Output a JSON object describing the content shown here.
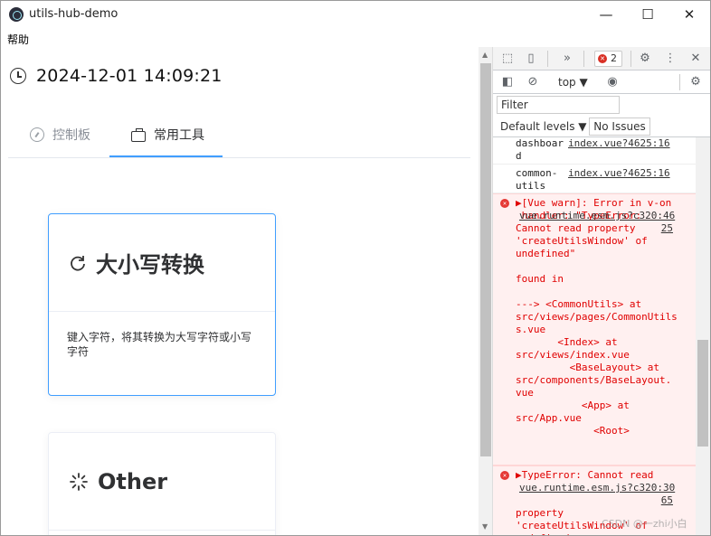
{
  "window": {
    "title": "utils-hub-demo",
    "minimize_glyph": "—",
    "maximize_glyph": "☐",
    "close_glyph": "✕"
  },
  "menu": {
    "help": "帮助"
  },
  "clock": {
    "datetime": "2024-12-01 14:09:21"
  },
  "tabs": [
    {
      "label": "控制板",
      "active": false
    },
    {
      "label": "常用工具",
      "active": true
    }
  ],
  "cards": [
    {
      "title": "大小写转换",
      "description": "键入字符，将其转换为大写字符或小写字符"
    },
    {
      "title": "Other"
    }
  ],
  "devtools": {
    "more_tools": "»",
    "error_count": "2",
    "context": "top",
    "filter_placeholder": "Filter",
    "default_levels": "Default levels",
    "no_issues": "No Issues",
    "logs": [
      {
        "message": "dashboar\nd",
        "link": "index.vue?4625:16"
      },
      {
        "message": "common-\nutils",
        "link": "index.vue?4625:16"
      }
    ],
    "errors": [
      {
        "text": "▶[Vue warn]: Error in v-on\n handler: \"TypeError:\nCannot read property\n'createUtilsWindow' of\nundefined\"\n\nfound in\n\n---> <CommonUtils> at\nsrc/views/pages/CommonUtils\ns.vue\n       <Index> at\nsrc/views/index.vue\n         <BaseLayout> at\nsrc/components/BaseLayout.\nvue\n           <App> at\nsrc/App.vue\n             <Root>",
        "link": "vue.runtime.esm.js?c320:46\n25"
      },
      {
        "text": "▶TypeError: Cannot read\n\n\nproperty\n'createUtilsWindow' of\nundefined",
        "link": "vue.runtime.esm.js?c320:30\n65"
      }
    ],
    "watermark": "CSDN @一zhi小白"
  },
  "colors": {
    "accent": "#409eff",
    "error": "#e00000",
    "error_bg": "#fff0f0"
  }
}
